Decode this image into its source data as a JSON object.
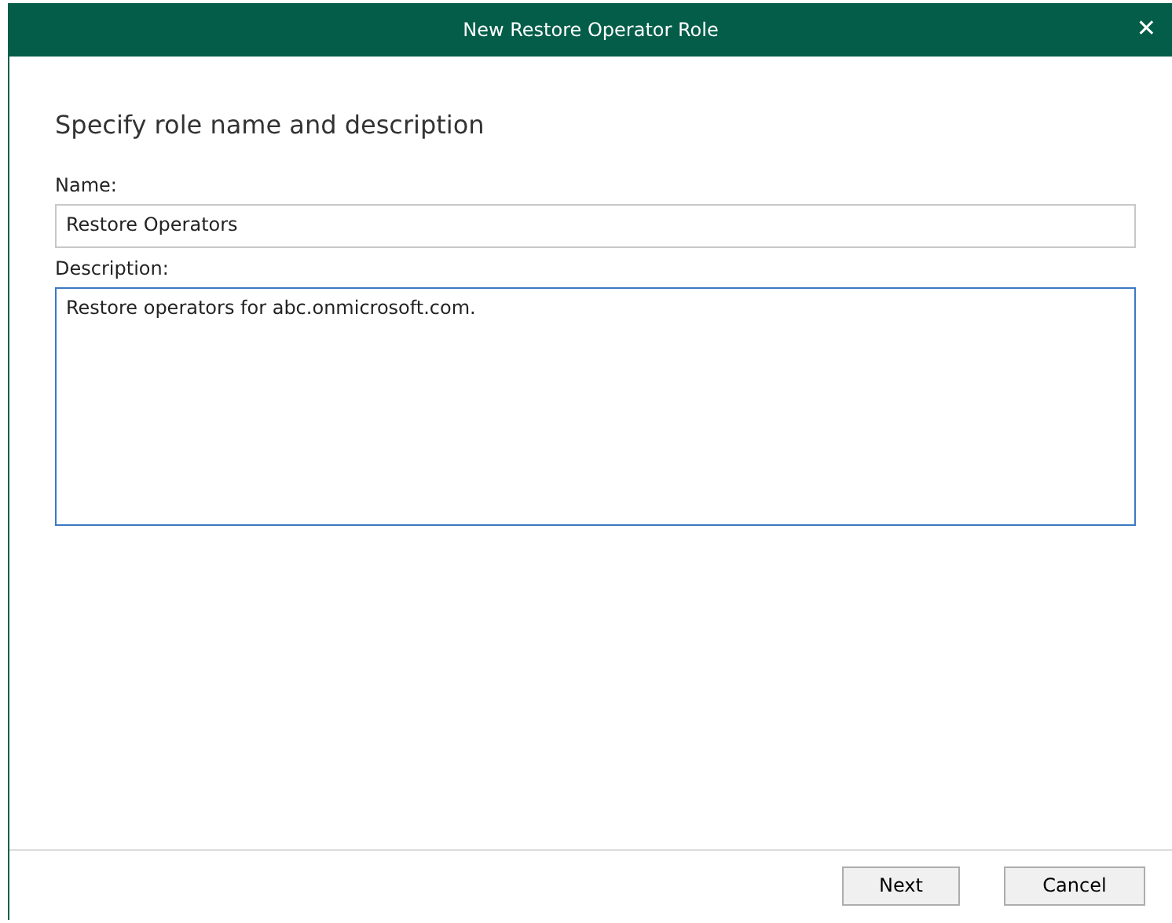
{
  "window": {
    "title": "New Restore Operator Role",
    "close": "✕"
  },
  "heading": "Specify role name and description",
  "fields": [
    {
      "kind": "line",
      "label": "Name:",
      "value": "Restore Operators",
      "focused": false
    },
    {
      "kind": "area",
      "label": "Description:",
      "value": "Restore operators for abc.onmicrosoft.com.",
      "focused": true
    }
  ],
  "buttons": [
    {
      "label": "Next"
    },
    {
      "label": "Cancel"
    }
  ]
}
